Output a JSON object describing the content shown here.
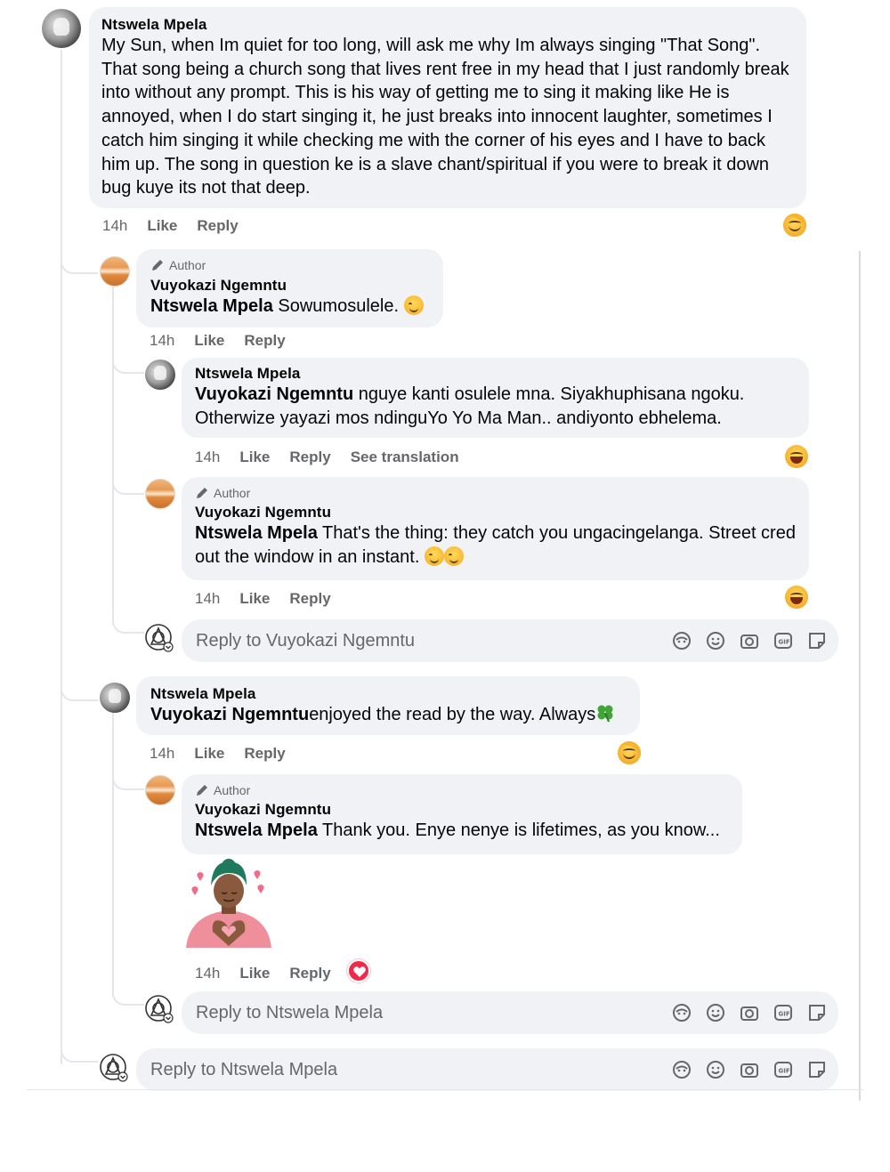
{
  "comment1": {
    "author": "Ntswela Mpela",
    "text": "My Sun, when Im quiet for too long, will ask me why Im always singing \"That Song\". That song being a church song that lives rent free in my head that I just randomly break into without any prompt. This is his way of getting me to sing it making like He is annoyed, when I do start singing it, he just breaks into innocent laughter, sometimes I catch him singing it while checking me with the corner of his eyes and I have to back him up. The song in question ke is a slave chant/spiritual if you were to break it down bug kuye its not that deep.",
    "time": "14h",
    "like": "Like",
    "reply": "Reply"
  },
  "reply1": {
    "badge": "Author",
    "author": "Vuyokazi Ngemntu",
    "tag": "Ntswela Mpela",
    "text": " Sowumosulele. ",
    "time": "14h",
    "like": "Like",
    "reply": "Reply"
  },
  "reply2": {
    "author": "Ntswela Mpela",
    "tag": "Vuyokazi Ngemntu",
    "text": " nguye kanti osulele mna. Siyakhuphisana ngoku. Otherwize yayazi mos ndinguYo Yo Ma Man.. andiyonto ebhelema.",
    "time": "14h",
    "like": "Like",
    "reply": "Reply",
    "translate": "See translation"
  },
  "reply3": {
    "badge": "Author",
    "author": "Vuyokazi Ngemntu",
    "tag": "Ntswela Mpela",
    "text": " That's the thing: they catch you ungacingelanga. Street cred out the window in an instant. ",
    "time": "14h",
    "like": "Like",
    "reply": "Reply"
  },
  "replybox1": {
    "placeholder": "Reply to Vuyokazi Ngemntu"
  },
  "comment2": {
    "author": "Ntswela Mpela",
    "tag": "Vuyokazi Ngemntu",
    "text": "enjoyed the read by the way. Always",
    "time": "14h",
    "like": "Like",
    "reply": "Reply"
  },
  "reply4": {
    "badge": "Author",
    "author": "Vuyokazi Ngemntu",
    "tag": "Ntswela Mpela",
    "text": " Thank you. Enye nenye is lifetimes, as you know...",
    "time": "14h",
    "like": "Like",
    "reply": "Reply"
  },
  "replybox2": {
    "placeholder": "Reply to Ntswela Mpela"
  },
  "replybox3": {
    "placeholder": "Reply to Ntswela Mpela"
  },
  "colors": {
    "bubble": "#f0f2f5",
    "meta": "#65676b",
    "heart": "#f0284a"
  }
}
